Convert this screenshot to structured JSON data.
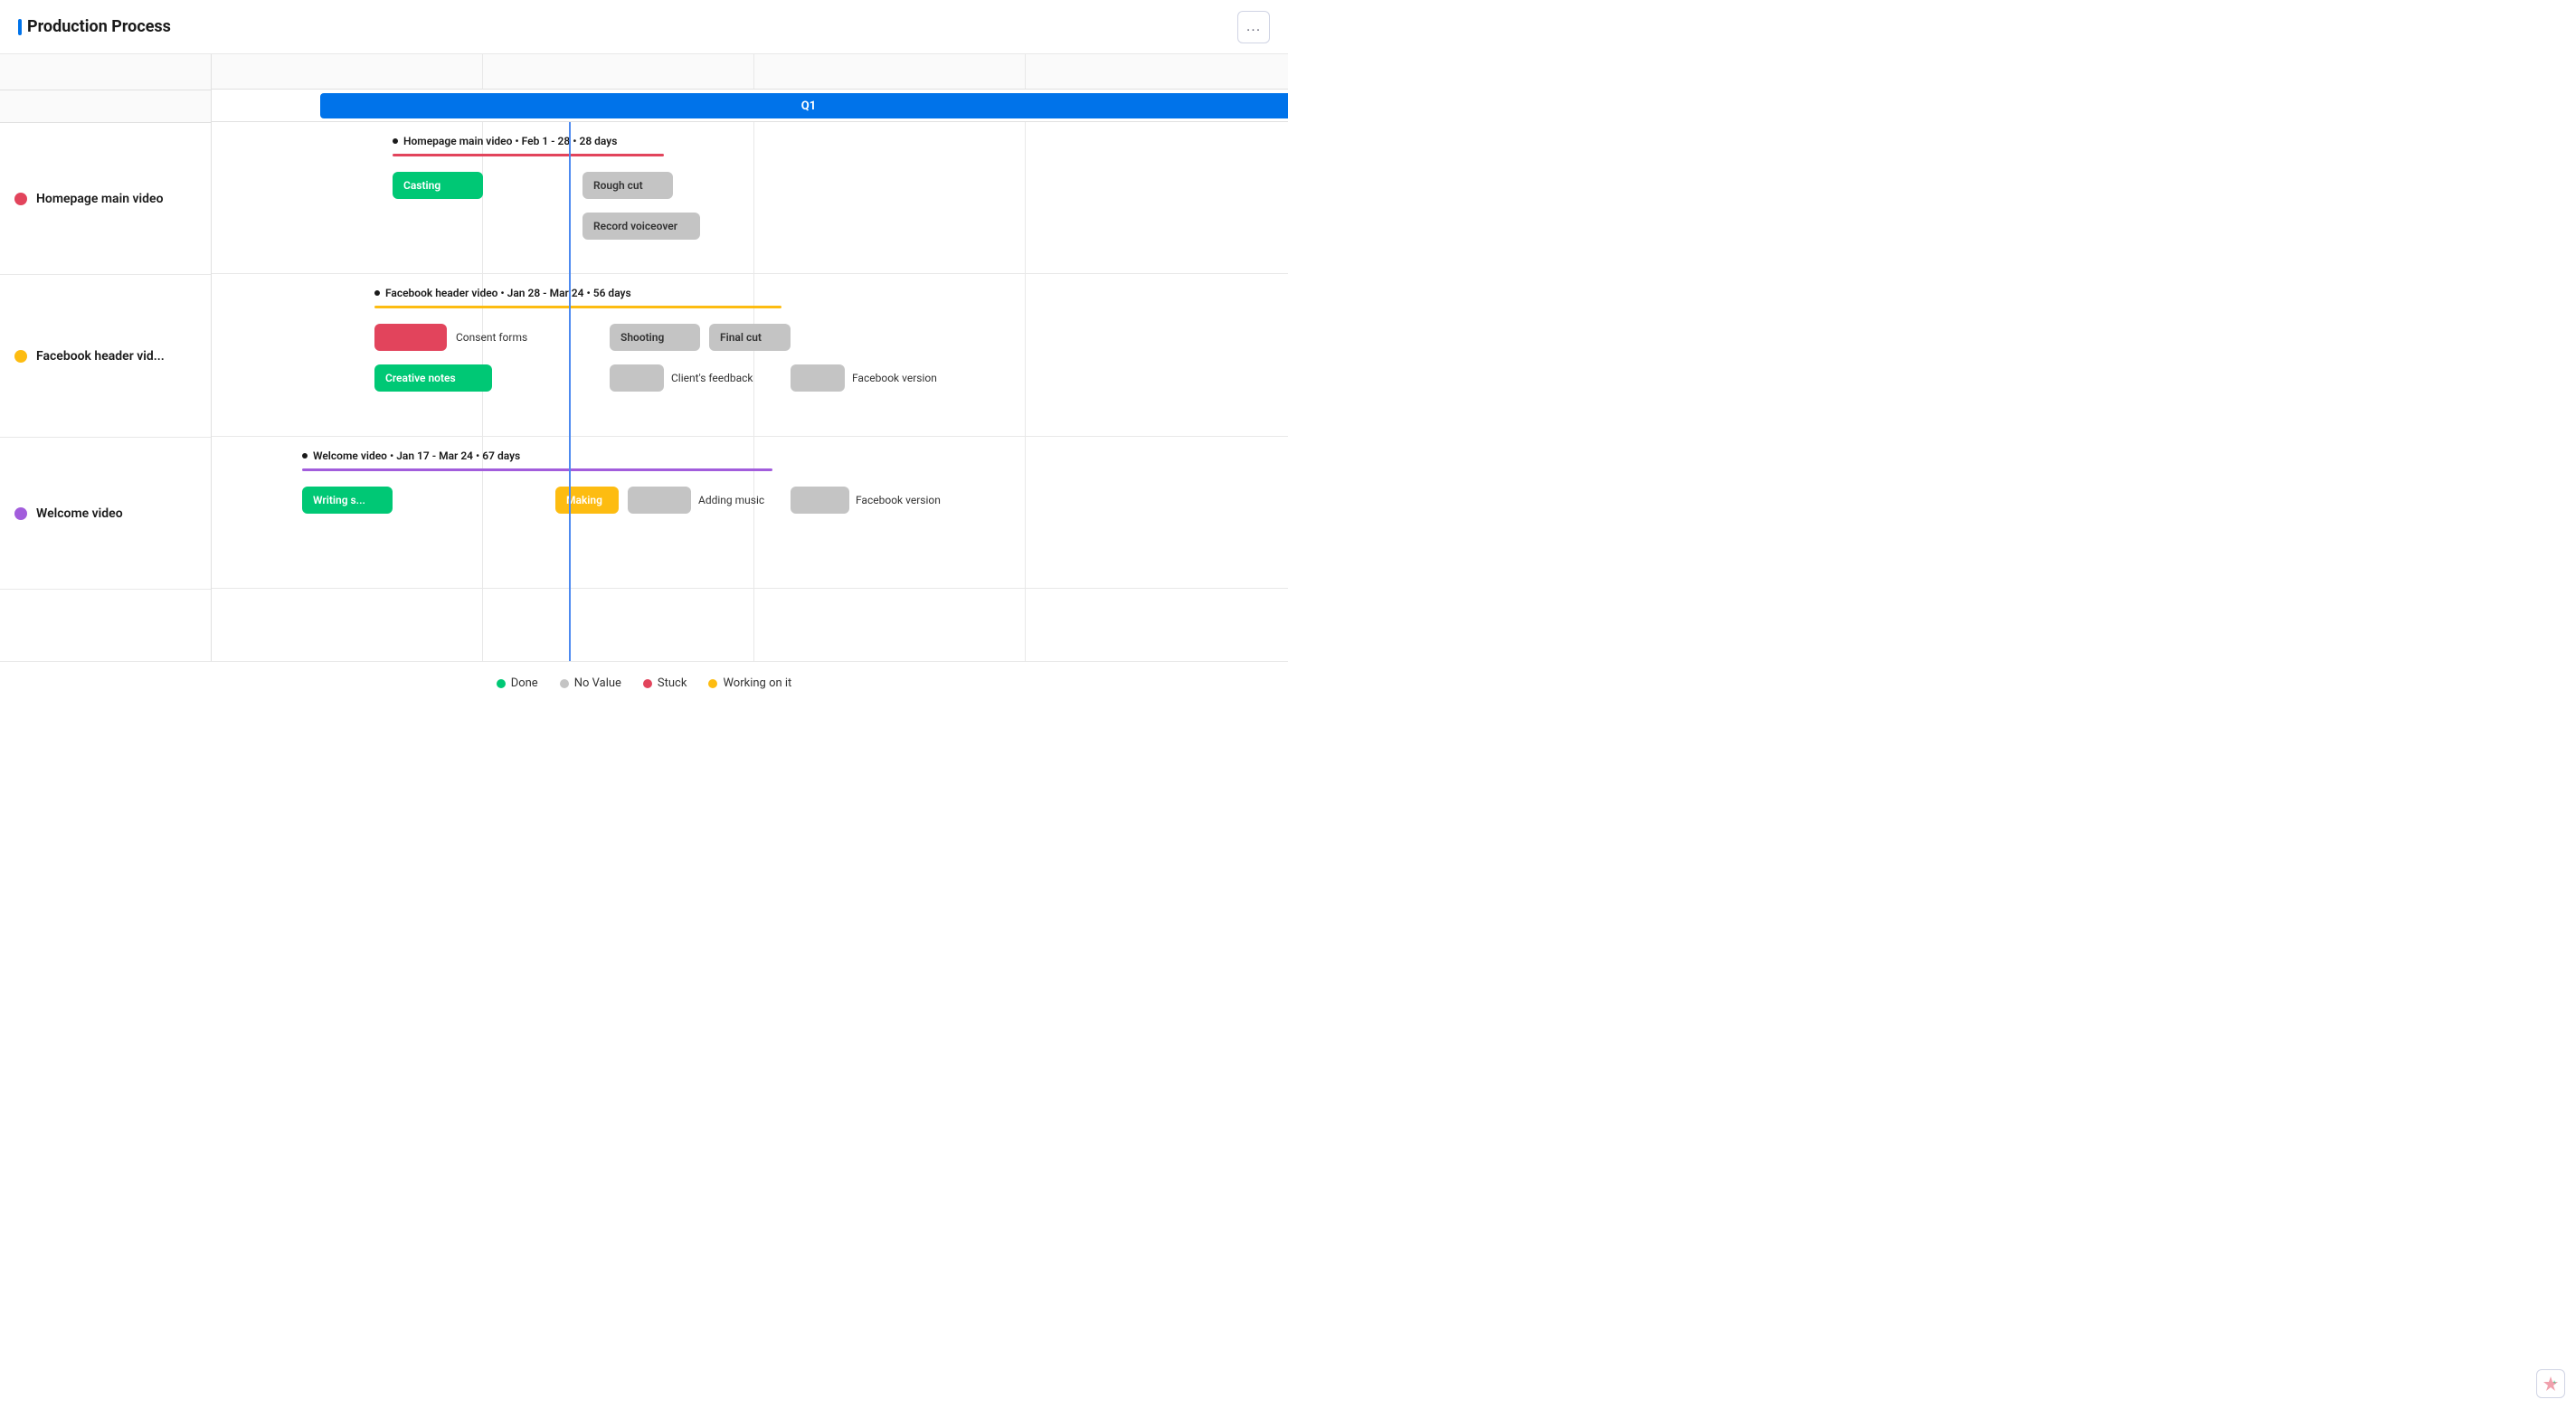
{
  "header": {
    "title": "Production Process",
    "more_button_label": "..."
  },
  "quarter": {
    "label": "Q1"
  },
  "tasks": {
    "homepage": {
      "name": "Homepage main video",
      "dot_color": "pink",
      "timeline_label": "Homepage main video • Feb 1 - 28 • 28 days",
      "items": [
        {
          "label": "Casting",
          "type": "green"
        },
        {
          "label": "Rough cut",
          "type": "gray"
        },
        {
          "label": "Record voiceover",
          "type": "gray"
        }
      ]
    },
    "facebook": {
      "name": "Facebook header vid...",
      "dot_color": "yellow",
      "timeline_label": "Facebook header video • Jan 28 - Mar 24 • 56 days",
      "items": [
        {
          "label": "Consent forms",
          "type": "red"
        },
        {
          "label": "Shooting",
          "type": "gray"
        },
        {
          "label": "Final cut",
          "type": "gray"
        },
        {
          "label": "Creative notes",
          "type": "green"
        },
        {
          "label": "Client's feedback",
          "type": "gray"
        },
        {
          "label": "Facebook version",
          "type": "gray"
        }
      ]
    },
    "welcome": {
      "name": "Welcome video",
      "dot_color": "purple",
      "timeline_label": "Welcome video • Jan 17 - Mar 24 • 67 days",
      "items": [
        {
          "label": "Writing s...",
          "type": "green"
        },
        {
          "label": "Making",
          "type": "orange"
        },
        {
          "label": "Adding music",
          "type": "gray"
        },
        {
          "label": "Facebook version",
          "type": "gray"
        }
      ]
    }
  },
  "legend": {
    "done": "Done",
    "no_value": "No Value",
    "stuck": "Stuck",
    "working": "Working on it"
  }
}
